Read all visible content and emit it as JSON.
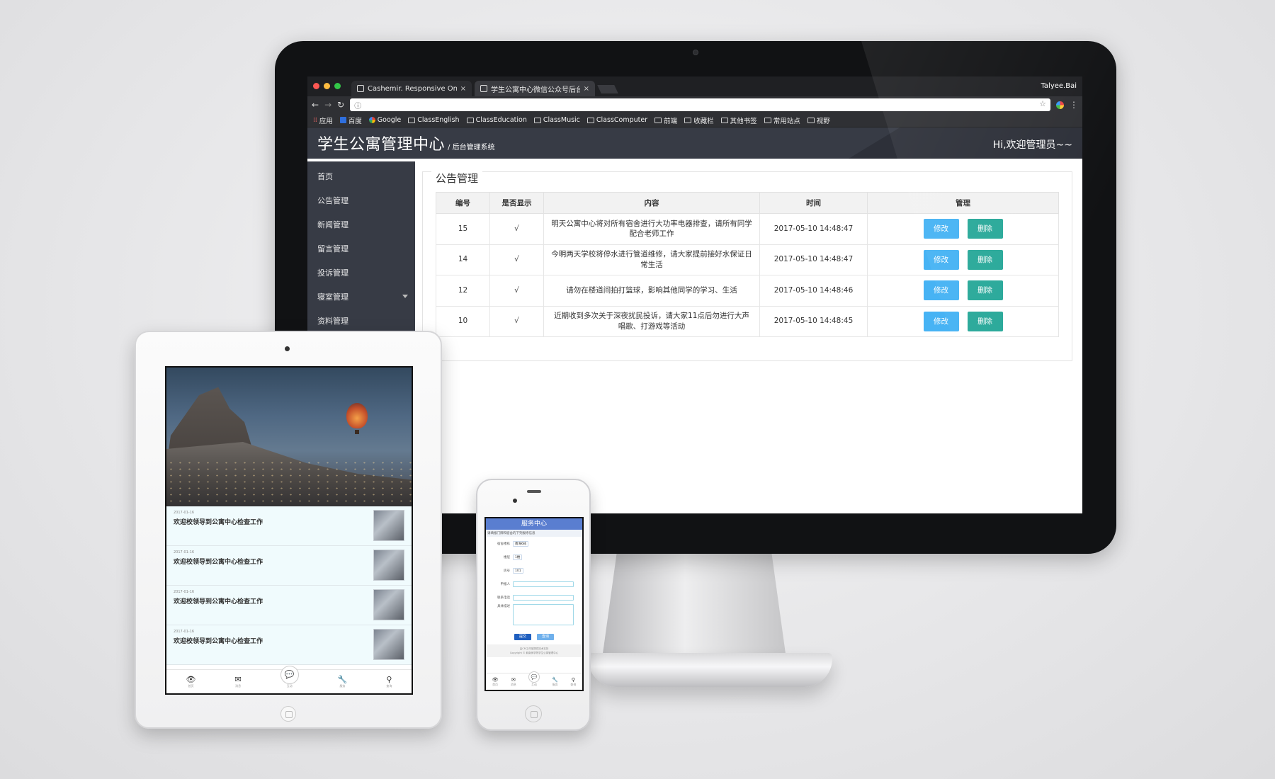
{
  "browser": {
    "tabs": [
      {
        "title": "Cashemir. Responsive One Pa",
        "close": "×"
      },
      {
        "title": "学生公寓中心微信公众号后台管",
        "close": "×"
      }
    ],
    "profile": "Talyee.Bai",
    "omnibox_icon": "ⓘ",
    "bookmarks": [
      {
        "label": "应用",
        "icon": "apps-icon"
      },
      {
        "label": "百度",
        "icon": "baidu-icon"
      },
      {
        "label": "Google",
        "icon": "google-icon"
      },
      {
        "label": "ClassEnglish",
        "icon": "folder-icon"
      },
      {
        "label": "ClassEducation",
        "icon": "folder-icon"
      },
      {
        "label": "ClassMusic",
        "icon": "folder-icon"
      },
      {
        "label": "ClassComputer",
        "icon": "folder-icon"
      },
      {
        "label": "前端",
        "icon": "folder-icon"
      },
      {
        "label": "收藏栏",
        "icon": "folder-icon"
      },
      {
        "label": "其他书签",
        "icon": "folder-icon"
      },
      {
        "label": "常用站点",
        "icon": "folder-icon"
      },
      {
        "label": "视野",
        "icon": "folder-icon"
      }
    ]
  },
  "app": {
    "title": "学生公寓管理中心",
    "subtitle": "/ 后台管理系统",
    "welcome": "Hi,欢迎管理员~~",
    "sidebar": [
      {
        "label": "首页"
      },
      {
        "label": "公告管理"
      },
      {
        "label": "新闻管理"
      },
      {
        "label": "留言管理"
      },
      {
        "label": "投诉管理"
      },
      {
        "label": "寝室管理"
      },
      {
        "label": "资料管理"
      }
    ],
    "panel_title": "公告管理",
    "table": {
      "headers": [
        "编号",
        "是否显示",
        "内容",
        "时间",
        "管理"
      ],
      "rows": [
        {
          "id": "15",
          "shown": "√",
          "content": "明天公寓中心将对所有宿舍进行大功率电器排查，请所有同学配合老师工作",
          "time": "2017-05-10 14:48:47"
        },
        {
          "id": "14",
          "shown": "√",
          "content": "今明两天学校将停水进行管道维修，请大家提前接好水保证日常生活",
          "time": "2017-05-10 14:48:47"
        },
        {
          "id": "12",
          "shown": "√",
          "content": "请勿在楼道间拍打篮球，影响其他同学的学习、生活",
          "time": "2017-05-10 14:48:46"
        },
        {
          "id": "10",
          "shown": "√",
          "content": "近期收到多次关于深夜扰民投诉，请大家11点后勿进行大声唱歌、打游戏等活动",
          "time": "2017-05-10 14:48:45"
        }
      ],
      "edit_label": "修改",
      "delete_label": "删除"
    }
  },
  "tablet": {
    "news": [
      {
        "date": "2017-01-16",
        "title": "欢迎校领导到公寓中心检查工作"
      },
      {
        "date": "2017-01-16",
        "title": "欢迎校领导到公寓中心检查工作"
      },
      {
        "date": "2017-01-16",
        "title": "欢迎校领导到公寓中心检查工作"
      },
      {
        "date": "2017-01-16",
        "title": "欢迎校领导到公寓中心检查工作"
      }
    ],
    "tabbar": [
      {
        "glyph": "👁",
        "label": "首页",
        "icon": "eye-icon"
      },
      {
        "glyph": "✉",
        "label": "消息",
        "icon": "mail-icon"
      },
      {
        "glyph": "💬",
        "label": "互动",
        "icon": "chat-icon"
      },
      {
        "glyph": "🔧",
        "label": "服务",
        "icon": "wrench-icon"
      },
      {
        "glyph": "⚲",
        "label": "查询",
        "icon": "search-icon"
      }
    ]
  },
  "phone": {
    "header": "服务中心",
    "notice": "请填报门牌和宿舍的下列报修信息",
    "fields": [
      {
        "label": "宿舍楼栋",
        "value": "南海6栋"
      },
      {
        "label": "楼层",
        "value": "1楼"
      },
      {
        "label": "房号",
        "value": "101"
      }
    ],
    "inputs": [
      {
        "label": "申报人"
      },
      {
        "label": "联系电话"
      }
    ],
    "textarea_label": "具体描述",
    "submit": "提交",
    "query": "查询",
    "footer_line1": "由CM工作室提供技术支持",
    "footer_line2": "Copyright © 韩南师学院学生公寓管理中心",
    "tabbar": [
      {
        "glyph": "👁",
        "label": "首页",
        "icon": "eye-icon"
      },
      {
        "glyph": "✉",
        "label": "消息",
        "icon": "mail-icon"
      },
      {
        "glyph": "💬",
        "label": "互动",
        "icon": "chat-icon"
      },
      {
        "glyph": "🔧",
        "label": "服务",
        "icon": "wrench-icon"
      },
      {
        "glyph": "⚲",
        "label": "查询",
        "icon": "search-icon"
      }
    ]
  },
  "colors": {
    "app_header": "#373b45",
    "edit_button": "#47b3f4",
    "delete_button": "#2aa99a",
    "phone_header": "#5a7ed0"
  }
}
